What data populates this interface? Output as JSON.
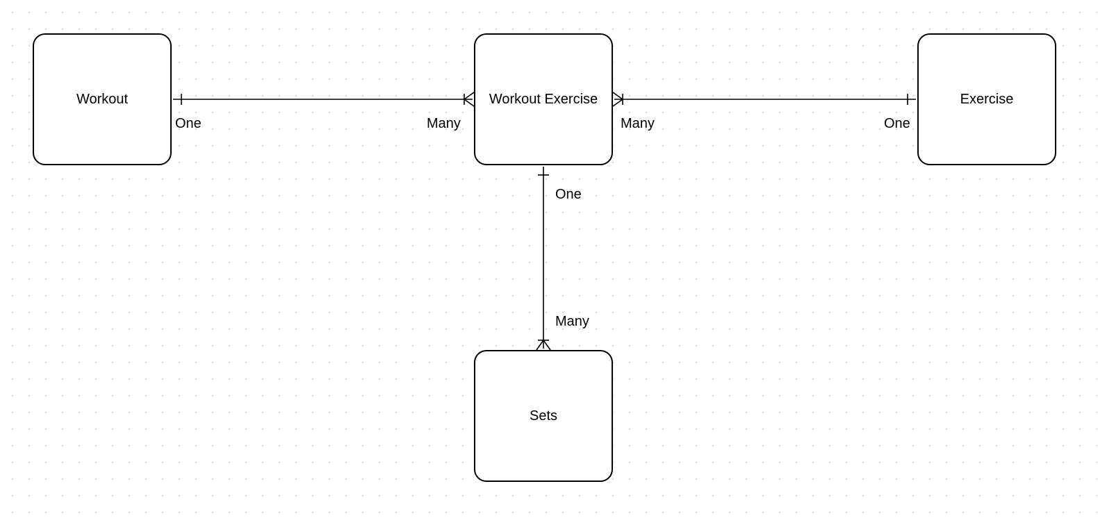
{
  "entities": {
    "workout": {
      "label": "Workout"
    },
    "workout_exercise": {
      "label": "Workout Exercise"
    },
    "exercise": {
      "label": "Exercise"
    },
    "sets": {
      "label": "Sets"
    }
  },
  "relationships": {
    "workout_to_we": {
      "left": "One",
      "right": "Many"
    },
    "exercise_to_we": {
      "left": "Many",
      "right": "One"
    },
    "we_to_sets": {
      "top": "One",
      "bottom": "Many"
    }
  }
}
